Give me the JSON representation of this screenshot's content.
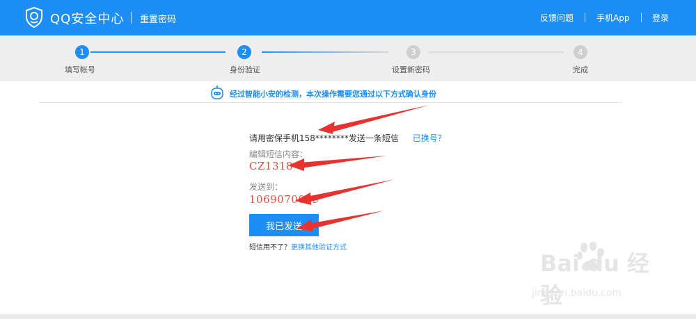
{
  "header": {
    "brand": "QQ安全中心",
    "subtitle": "重置密码",
    "nav": [
      "反馈问题",
      "手机App",
      "登录"
    ]
  },
  "steps": [
    {
      "num": "1",
      "label": "填写帐号",
      "state": "done"
    },
    {
      "num": "2",
      "label": "身份验证",
      "state": "current"
    },
    {
      "num": "3",
      "label": "设置新密码",
      "state": "todo"
    },
    {
      "num": "4",
      "label": "完成",
      "state": "todo"
    }
  ],
  "notice": "经过智能小安的检测，本次操作需要您通过以下方式确认身份",
  "form": {
    "sms_prompt": "请用密保手机158********发送一条短信",
    "change_number_link": "已换号？",
    "content_label": "编辑短信内容：",
    "content_value": "CZ1318",
    "send_to_label": "发送到：",
    "send_to_value": "1069070069",
    "sent_button": "我已发送",
    "alt_prefix": "短信用不了？",
    "alt_link": "更换其他验证方式"
  },
  "watermark": {
    "brand": "Bai du 经验",
    "url": "jingyan.baidu.com"
  },
  "colors": {
    "primary": "#1d8ef5",
    "accent_red": "#e74c3c",
    "step_inactive": "#cfcfcf",
    "steps_bg": "#eeeeee"
  }
}
